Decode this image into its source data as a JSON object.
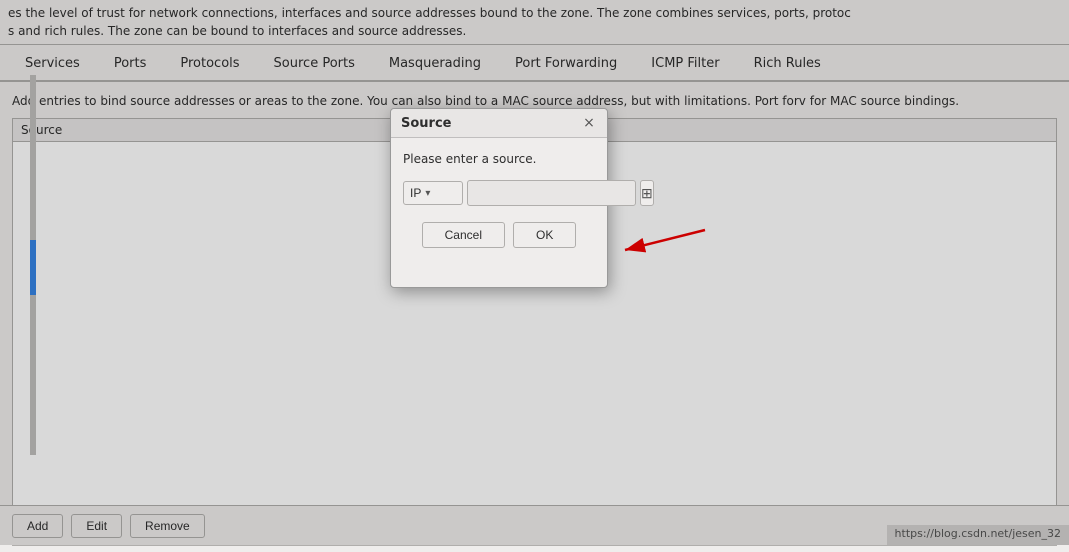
{
  "topDesc": {
    "line1": "es the level of trust for network connections, interfaces and source addresses bound to the zone. The zone combines services, ports, protoc",
    "line2": "s and rich rules. The zone can be bound to interfaces and source addresses."
  },
  "tabs": {
    "items": [
      {
        "label": "Services"
      },
      {
        "label": "Ports"
      },
      {
        "label": "Protocols"
      },
      {
        "label": "Source Ports"
      },
      {
        "label": "Masquerading"
      },
      {
        "label": "Port Forwarding"
      },
      {
        "label": "ICMP Filter"
      },
      {
        "label": "Rich Rules"
      }
    ]
  },
  "mainDesc": {
    "text": "Add entries to bind source addresses or areas to the zone. You can also bind to a MAC source address, but with limitations. Port forv for MAC source bindings."
  },
  "table": {
    "header": "Source"
  },
  "bottomButtons": {
    "add": "Add",
    "edit": "Edit",
    "remove": "Remove"
  },
  "modal": {
    "title": "Source",
    "closeLabel": "×",
    "prompt": "Please enter a source.",
    "dropdownLabel": "IP",
    "dropdownArrow": "▾",
    "inputPlaceholder": "",
    "browseBtnIcon": "⊞",
    "cancelLabel": "Cancel",
    "okLabel": "OK"
  },
  "statusBar": {
    "url": "https://blog.csdn.net/jesen_32"
  }
}
